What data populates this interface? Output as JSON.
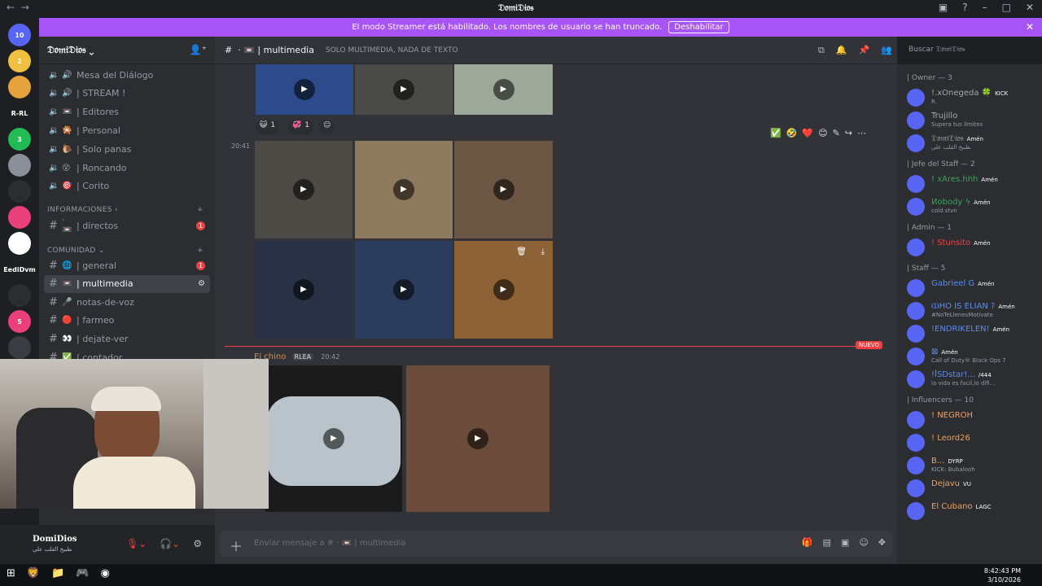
{
  "window": {
    "title": "𝔇𝔬𝔪𝔦𝔇𝔦𝔬𝔰",
    "back": "←",
    "forward": "→"
  },
  "streamer_banner": {
    "text": "El modo Streamer está habilitado. Los nombres de usuario se han truncado.",
    "button": "Deshabilitar",
    "close": "✕"
  },
  "servers": [
    {
      "label": "10",
      "color": "#5865f2"
    },
    {
      "label": "2",
      "color": "#f0c040"
    },
    {
      "label": "",
      "color": "#e6a23c"
    },
    {
      "label": "R-RL",
      "color": "#1e1f22"
    },
    {
      "label": "3",
      "color": "#2b5"
    },
    {
      "label": "",
      "color": "#8a8f98"
    },
    {
      "label": "",
      "color": "#2b2d31"
    },
    {
      "label": "",
      "color": "#e9407a"
    },
    {
      "label": "",
      "color": "#ffffff"
    },
    {
      "label": "EediDvm",
      "color": "#1e1f22"
    },
    {
      "label": "",
      "color": "#2b2d31"
    },
    {
      "label": "5",
      "color": "#e9407a"
    },
    {
      "label": "",
      "color": "#3a3c42"
    }
  ],
  "guild": {
    "name": "𝔇𝔬𝔪𝔦𝔇𝔦𝔬𝔰 ⌄"
  },
  "voice_channels": [
    {
      "emoji": "🔊",
      "name": "Mesa del Diálogo"
    },
    {
      "emoji": "🔊",
      "name": "| STREAM !"
    },
    {
      "emoji": "📼",
      "name": "| Editores"
    },
    {
      "emoji": "🎇",
      "name": "| Personal"
    },
    {
      "emoji": "🐌",
      "name": "| Solo panas"
    },
    {
      "emoji": "😵",
      "name": "| Roncando"
    },
    {
      "emoji": "🎯",
      "name": "| Corito"
    }
  ],
  "categories": {
    "informaciones": "INFORMACIONES ›",
    "comunidad": "COMUNIDAD ⌄"
  },
  "text_channels_info": [
    {
      "name": "| directos",
      "badge": "1"
    }
  ],
  "text_channels": [
    {
      "emoji": "🌐",
      "name": "| general",
      "badge": "1",
      "active": false
    },
    {
      "emoji": "📼",
      "name": "| multimedia",
      "badge": "",
      "active": true
    },
    {
      "emoji": "🎤",
      "name": "notas-de-voz",
      "badge": "",
      "active": false
    },
    {
      "emoji": "🔴",
      "name": "| farmeo",
      "badge": "",
      "active": false
    },
    {
      "emoji": "👀",
      "name": "| dejate-ver",
      "badge": "",
      "active": false
    },
    {
      "emoji": "✅",
      "name": "| contador",
      "badge": "",
      "active": false
    }
  ],
  "channel_header": {
    "name": "multimedia",
    "topic": "SOLO MULTIMEDIA, NADA DE TEXTO"
  },
  "search": {
    "placeholder": "Buscar 𝔇𝔬𝔪𝔦𝔇𝔦𝔬𝔰"
  },
  "messages": {
    "reactions": [
      {
        "emoji": "😺",
        "count": "1"
      },
      {
        "emoji": "💞",
        "count": "1"
      }
    ],
    "timestamp1": "20:41",
    "new_label": "NUEVO",
    "author": "El chino",
    "author_tag": "RLEA",
    "timestamp2": "20:42",
    "hover_actions": [
      "✅",
      "🤣",
      "❤️",
      "😊",
      "✎",
      "↪",
      "⋯"
    ]
  },
  "composer": {
    "placeholder": "Enviar mensaje a # · 📼 | multimedia"
  },
  "user_panel": {
    "name": "DomiDios",
    "status": "ﻄﺒﻴﺦ ﺍﻟﻘﻠﺐ ﻋﻠﻲ"
  },
  "members": {
    "groups": [
      {
        "title": "| Owner — 3",
        "members": [
          {
            "name": "!.xOnegeda 🍀",
            "role": "KICK",
            "sub": "R.",
            "color": "#a7a9ac"
          },
          {
            "name": "Trujillo",
            "role": "",
            "sub": "Supera tus límites",
            "color": "#a7a9ac"
          },
          {
            "name": "𝔇𝔬𝔪𝔦𝔇𝔦𝔬𝔰",
            "role": "Amén",
            "sub": "ﻄﺒﻴﺦ ﺍﻟﻘﻠﺐ ﻋﻠﻲ",
            "color": "#a7a9ac"
          }
        ]
      },
      {
        "title": "| Jefe del Staff — 2",
        "members": [
          {
            "name": "! xAres.hhh",
            "role": "Amén",
            "sub": "",
            "color": "#3ba55d"
          },
          {
            "name": "Иobody ϟ",
            "role": "Amén",
            "sub": "cold.stvn",
            "color": "#3ba55d"
          }
        ]
      },
      {
        "title": "| Admin — 1",
        "members": [
          {
            "name": "! Stunsito",
            "role": "Amén",
            "sub": "",
            "color": "#ed4245"
          }
        ]
      },
      {
        "title": "| Staff — 5",
        "members": [
          {
            "name": "Gabrieel G",
            "role": "Amén",
            "sub": "",
            "color": "#5b8def"
          },
          {
            "name": "ⲰHO IS ELIAN ?",
            "role": "Amén",
            "sub": "#NoTeLlenesMotivate",
            "color": "#5b8def"
          },
          {
            "name": "!ENDRIKELEN!",
            "role": "Amén",
            "sub": "",
            "color": "#5b8def"
          },
          {
            "name": "⊠",
            "role": "Amén",
            "sub": "Call of Duty® Black Ops 7",
            "color": "#5b8def"
          },
          {
            "name": "!ꟾSDstar!...",
            "role": "/444",
            "sub": "la vida es facil,lo difi...",
            "color": "#5b8def"
          }
        ]
      },
      {
        "title": "| Influencers — 10",
        "members": [
          {
            "name": "! NEGROH",
            "role": "",
            "sub": "",
            "color": "#f0a35e"
          },
          {
            "name": "! Leord26",
            "role": "",
            "sub": "",
            "color": "#f0a35e"
          },
          {
            "name": "B...",
            "role": "DYRP",
            "sub": "KICK: Bubalooh",
            "color": "#f0a35e"
          },
          {
            "name": "Dejavu",
            "role": "VU",
            "sub": "",
            "color": "#f0a35e"
          },
          {
            "name": "El Cubano",
            "role": "LAGC",
            "sub": "",
            "color": "#f0a35e"
          }
        ]
      }
    ]
  },
  "taskbar": {
    "time": "8:42:43 PM",
    "date": "3/10/2026"
  },
  "colors": {
    "accent": "#5865f2",
    "streamer": "#a855f7",
    "danger": "#f23f43"
  }
}
